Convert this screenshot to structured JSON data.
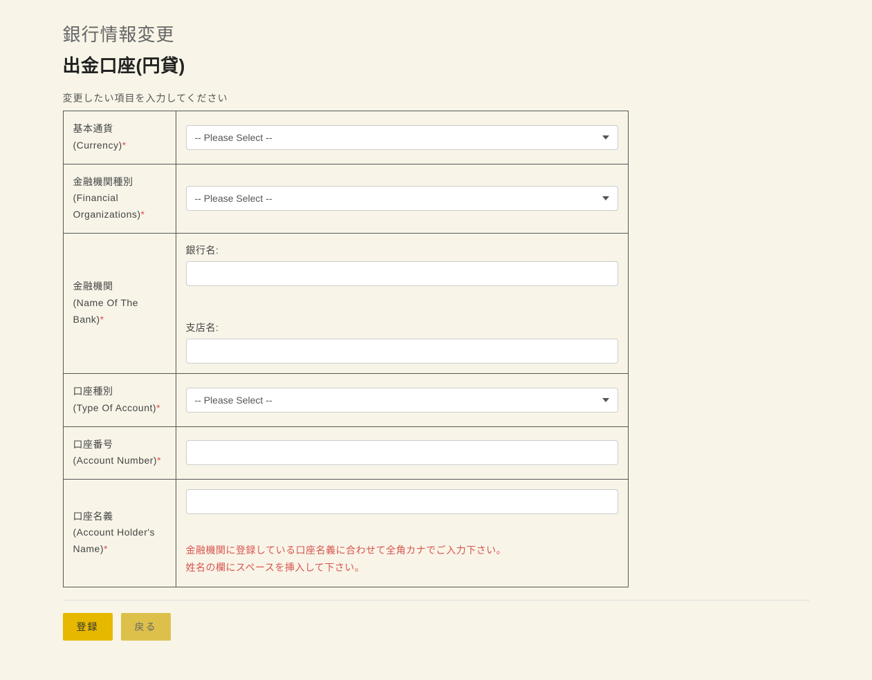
{
  "header": {
    "title": "銀行情報変更",
    "subtitle": "出金口座(円貸)"
  },
  "instruction": "変更したい項目を入力してください",
  "fields": {
    "currency": {
      "label_jp": "基本通貨",
      "label_en": "(Currency)",
      "required_mark": "*",
      "select_placeholder": "-- Please Select --"
    },
    "financial_org": {
      "label_jp": "金融機関種別",
      "label_en": "(Financial Organizations)",
      "required_mark": "*",
      "select_placeholder": "-- Please Select --"
    },
    "bank_name": {
      "label_jp": "金融機関",
      "label_en": "(Name Of The Bank)",
      "required_mark": "*",
      "bank_label": "銀行名:",
      "branch_label": "支店名:"
    },
    "account_type": {
      "label_jp": "口座種別",
      "label_en": "(Type Of Account)",
      "required_mark": "*",
      "select_placeholder": "-- Please Select --"
    },
    "account_number": {
      "label_jp": "口座番号",
      "label_en": "(Account Number)",
      "required_mark": "*"
    },
    "account_holder": {
      "label_jp": "口座名義",
      "label_en": "(Account Holder's Name)",
      "required_mark": "*",
      "help_line1": "金融機関に登録している口座名義に合わせて全角カナでご入力下さい。",
      "help_line2": "姓名の欄にスペースを挿入して下さい。"
    }
  },
  "buttons": {
    "submit": "登録",
    "back": "戻る"
  }
}
